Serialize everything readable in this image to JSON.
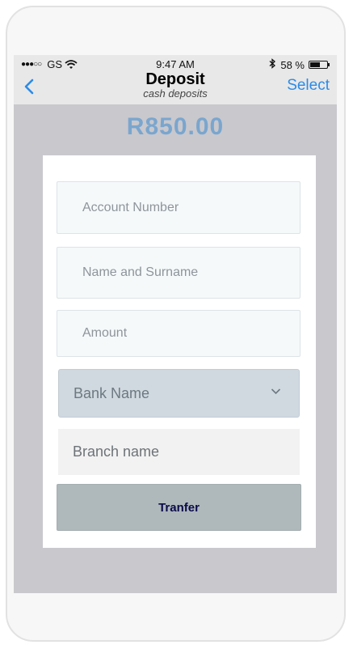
{
  "status_bar": {
    "signal": "●●●○○",
    "carrier": "GS",
    "time": "9:47 AM",
    "battery_percent": "58 %",
    "battery_level": 0.58,
    "icons": [
      "wifi-icon",
      "bluetooth-icon",
      "battery-icon"
    ]
  },
  "nav": {
    "back_icon": "chevron-left-icon",
    "title": "Deposit",
    "subtitle": "cash deposits",
    "select_label": "Select"
  },
  "amount_display": "R850.00",
  "form": {
    "account_number_placeholder": "Account Number",
    "name_placeholder": "Name and Surname",
    "amount_placeholder": "Amount",
    "bank_select_value": "Bank Name",
    "bank_select_icon": "chevron-down-icon",
    "branch_placeholder": "Branch name",
    "submit_label": "Tranfer"
  },
  "colors": {
    "accent": "#2b8be8",
    "amount": "#7aa6ce",
    "screen_background": "#c9c8cd",
    "button": "#afb8bb"
  }
}
